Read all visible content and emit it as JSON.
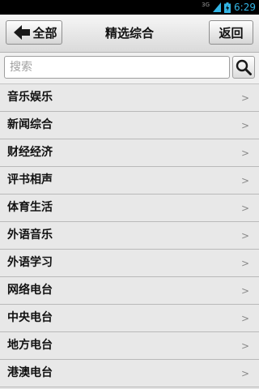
{
  "status_bar": {
    "network": "3G",
    "time": "6:29"
  },
  "header": {
    "back_label": "全部",
    "title": "精选综合",
    "return_label": "返回"
  },
  "search": {
    "placeholder": "搜索",
    "value": ""
  },
  "categories": [
    {
      "label": "音乐娱乐",
      "chevron": ">"
    },
    {
      "label": "新闻综合",
      "chevron": ">"
    },
    {
      "label": "财经经济",
      "chevron": ">"
    },
    {
      "label": "评书相声",
      "chevron": ">"
    },
    {
      "label": "体育生活",
      "chevron": ">"
    },
    {
      "label": "外语音乐",
      "chevron": ">"
    },
    {
      "label": "外语学习",
      "chevron": ">"
    },
    {
      "label": "网络电台",
      "chevron": ">"
    },
    {
      "label": "中央电台",
      "chevron": ">"
    },
    {
      "label": "地方电台",
      "chevron": ">"
    },
    {
      "label": "港澳电台",
      "chevron": ">"
    }
  ],
  "colors": {
    "status_accent": "#33b5e5",
    "list_background": "#e8e8e8",
    "divider": "#b9b9b9"
  }
}
